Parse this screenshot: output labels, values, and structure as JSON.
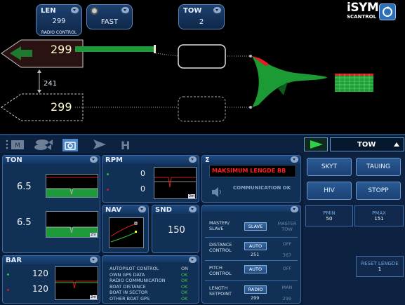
{
  "header": {
    "len": {
      "label": "LEN",
      "value": "299",
      "sub": "RADIO CONTROL"
    },
    "speed": {
      "value": "FAST"
    },
    "tow": {
      "label": "TOW",
      "value": "2"
    },
    "logo": {
      "line1": "iSYM",
      "line2": "SCANTROL"
    }
  },
  "view": {
    "upper_length": "299",
    "lower_length": "299",
    "distance": "241"
  },
  "right": {
    "mode": "TOW",
    "buttons": [
      "SKYT",
      "TAUING",
      "HIV",
      "STOPP"
    ],
    "pmin": {
      "label": "PMIN",
      "value": "50"
    },
    "pmax": {
      "label": "PMAX",
      "value": "151"
    },
    "reset": {
      "label": "RESET LENGDE",
      "value": "1"
    }
  },
  "ton": {
    "title": "TON",
    "upper": "6.5",
    "lower": "6.5",
    "chart_label": "2m"
  },
  "rpm": {
    "title": "RPM",
    "upper": "0",
    "lower": "0",
    "chart_label": "2m"
  },
  "nav": {
    "title": "NAV"
  },
  "snd": {
    "title": "SND",
    "value": "150"
  },
  "bar": {
    "title": "BAR",
    "upper": "120",
    "lower": "120",
    "chart_label": "2m"
  },
  "alarm": {
    "title": "Σ",
    "message": "MAKSIMUM LENGDE BB",
    "status": "COMMUNICATION OK"
  },
  "control": {
    "rows": [
      {
        "label": "MASTER/\nSLAVE",
        "button": "SLAVE",
        "value": "",
        "right": "MASTER\nTOW"
      },
      {
        "label": "DISTANCE\nCONTROL",
        "button": "AUTO",
        "value": "251",
        "right": "OFF\n\n367"
      },
      {
        "label": "PITCH\nCONTROL",
        "button": "AUTO",
        "value": "",
        "right": "OFF"
      },
      {
        "label": "LENGTH\nSETPOINT",
        "button": "RADIO",
        "value": "299",
        "right": "MAN\n\n299"
      }
    ]
  },
  "status": {
    "items": [
      {
        "label": "AUTOPILOT CONTROL",
        "value": "ON",
        "color": "#d0d0d0"
      },
      {
        "label": "OWN GPS DATA",
        "value": "OK",
        "color": "#3fc43f"
      },
      {
        "label": "RADIO COMMUNICATION",
        "value": "OK",
        "color": "#3fc43f"
      },
      {
        "label": "BOAT DISTANCE",
        "value": "OK",
        "color": "#3fc43f"
      },
      {
        "label": "BOAT IN SECTOR",
        "value": "OK",
        "color": "#3fc43f"
      },
      {
        "label": "OTHER BOAT GPS",
        "value": "OK",
        "color": "#3fc43f"
      }
    ]
  },
  "colors": {
    "green": "#1e9a3a",
    "red": "#e02020",
    "accent": "#3a6aa8"
  }
}
